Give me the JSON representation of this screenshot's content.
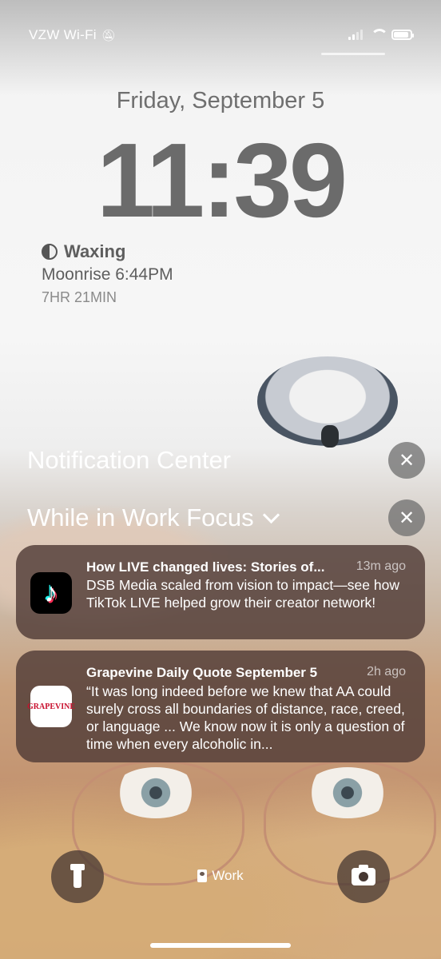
{
  "status_bar": {
    "carrier": "VZW Wi-Fi",
    "silent_icon": "bell-slash-icon"
  },
  "lock_screen": {
    "date": "Friday, September 5",
    "time": "11:39"
  },
  "moon_widget": {
    "phase": "Waxing",
    "moonrise": "Moonrise 6:44PM",
    "countdown": "7HR 21MIN"
  },
  "notification_center": {
    "title": "Notification Center",
    "focus_group_title": "While in Work Focus",
    "notifications": [
      {
        "app": "TikTok",
        "icon": "tiktok-icon",
        "title": "How LIVE changed lives: Stories of...",
        "time_ago": "13m ago",
        "body": "DSB Media scaled from vision to impact—see how TikTok LIVE helped grow their creator network!"
      },
      {
        "app": "Grapevine",
        "icon_text": "GRAPEVINE",
        "title": "Grapevine Daily Quote September 5",
        "time_ago": "2h ago",
        "body": "“It was long indeed before we knew that AA could surely cross all boundaries of distance, race, creed, or language ... We know now it is only a question of time when every alcoholic in..."
      }
    ]
  },
  "bottom_controls": {
    "focus_label": "Work"
  }
}
